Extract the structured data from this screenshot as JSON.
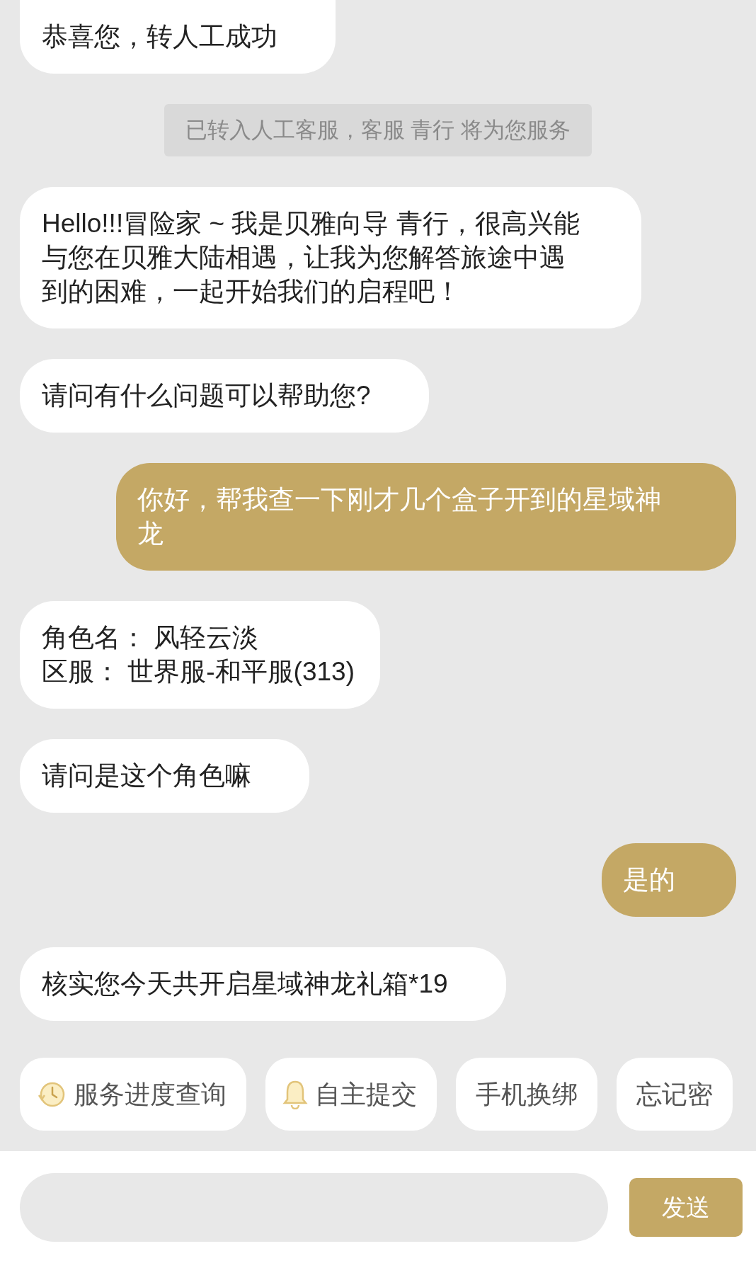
{
  "messages": [
    {
      "kind": "agent",
      "text": "恭喜您，转人工成功"
    },
    {
      "kind": "notice",
      "text": "已转入人工客服，客服 青行 将为您服务"
    },
    {
      "kind": "agent",
      "text": "Hello!!!冒险家 ~ 我是贝雅向导 青行，很高兴能与您在贝雅大陆相遇，让我为您解答旅途中遇到的困难，一起开始我们的启程吧！"
    },
    {
      "kind": "agent",
      "text": "请问有什么问题可以帮助您?"
    },
    {
      "kind": "user",
      "text": "你好，帮我查一下刚才几个盒子开到的星域神龙"
    },
    {
      "kind": "agent_lines",
      "lines": [
        "角色名： 风轻云淡",
        "区服： 世界服-和平服(313)"
      ]
    },
    {
      "kind": "agent",
      "text": "请问是这个角色嘛"
    },
    {
      "kind": "user",
      "text": "是的"
    },
    {
      "kind": "agent",
      "text": "核实您今天共开启星域神龙礼箱*19"
    }
  ],
  "quick_replies": [
    {
      "label": "服务进度查询",
      "kind": "clock"
    },
    {
      "label": "自主提交",
      "kind": "bell"
    },
    {
      "label": "手机换绑",
      "kind": "plain"
    },
    {
      "label": "忘记密",
      "kind": "plain"
    }
  ],
  "send_button": "发送"
}
